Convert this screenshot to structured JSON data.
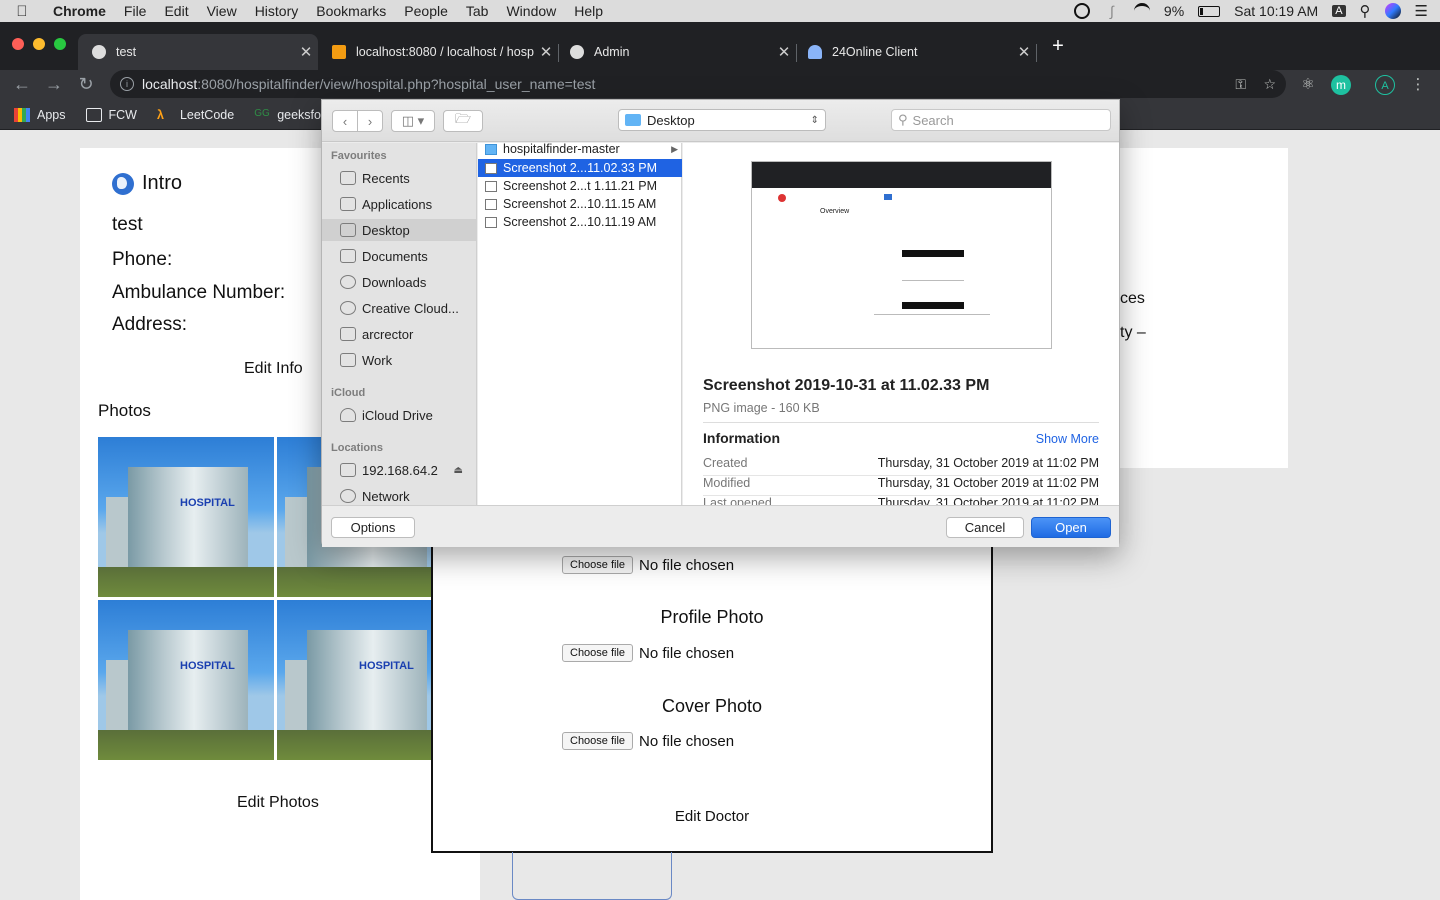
{
  "menubar": {
    "app": "Chrome",
    "items": [
      "File",
      "Edit",
      "View",
      "History",
      "Bookmarks",
      "People",
      "Tab",
      "Window",
      "Help"
    ],
    "battery": "9%",
    "clock": "Sat 10:19 AM",
    "input_source": "A"
  },
  "tabs": [
    {
      "title": "test",
      "active": true
    },
    {
      "title": "localhost:8080 / localhost / hosp",
      "active": false
    },
    {
      "title": "Admin",
      "active": false
    },
    {
      "title": "24Online Client",
      "active": false
    }
  ],
  "omnibox": {
    "host": "localhost",
    "path": ":8080/hospitalfinder/view/hospital.php?hospital_user_name=test"
  },
  "bookmarks": [
    "Apps",
    "FCW",
    "LeetCode",
    "geeksforg"
  ],
  "page": {
    "intro_title": "Intro",
    "name": "test",
    "phone_label": "Phone:",
    "ambulance_label": "Ambulance Number:",
    "address_label": "Address:",
    "edit_info": "Edit Info",
    "photos_label": "Photos",
    "photo_sign": "HOSPITAL",
    "edit_photos": "Edit Photos",
    "right_text_1": "ces",
    "right_text_2": "ty –"
  },
  "modal": {
    "choose_label": "Choose file",
    "no_file": "No file chosen",
    "profile_heading": "Profile Photo",
    "cover_heading": "Cover Photo",
    "edit_doctor": "Edit Doctor"
  },
  "dialog": {
    "location": "Desktop",
    "search_placeholder": "Search",
    "sidebar": {
      "favourites_head": "Favourites",
      "favourites": [
        "Recents",
        "Applications",
        "Desktop",
        "Documents",
        "Downloads",
        "Creative Cloud...",
        "arcrector",
        "Work"
      ],
      "icloud_head": "iCloud",
      "icloud": [
        "iCloud Drive"
      ],
      "locations_head": "Locations",
      "locations": [
        "192.168.64.2",
        "Network"
      ]
    },
    "files": [
      {
        "name": "hospitalfinder-master",
        "type": "folder"
      },
      {
        "name": "Screenshot 2...11.02.33 PM",
        "type": "image",
        "selected": true
      },
      {
        "name": "Screenshot 2...t 1.11.21 PM",
        "type": "image"
      },
      {
        "name": "Screenshot 2...10.11.15 AM",
        "type": "image"
      },
      {
        "name": "Screenshot 2...10.11.19 AM",
        "type": "image"
      }
    ],
    "preview": {
      "thumb_title": "Overview",
      "name": "Screenshot 2019-10-31 at 11.02.33 PM",
      "type": "PNG image - 160 KB",
      "info_head": "Information",
      "show_more": "Show More",
      "meta": [
        {
          "key": "Created",
          "value": "Thursday, 31 October 2019 at 11:02 PM"
        },
        {
          "key": "Modified",
          "value": "Thursday, 31 October 2019 at 11:02 PM"
        },
        {
          "key": "Last opened",
          "value": "Thursday, 31 October 2019 at 11:02 PM"
        }
      ]
    },
    "options_label": "Options",
    "cancel_label": "Cancel",
    "open_label": "Open"
  }
}
